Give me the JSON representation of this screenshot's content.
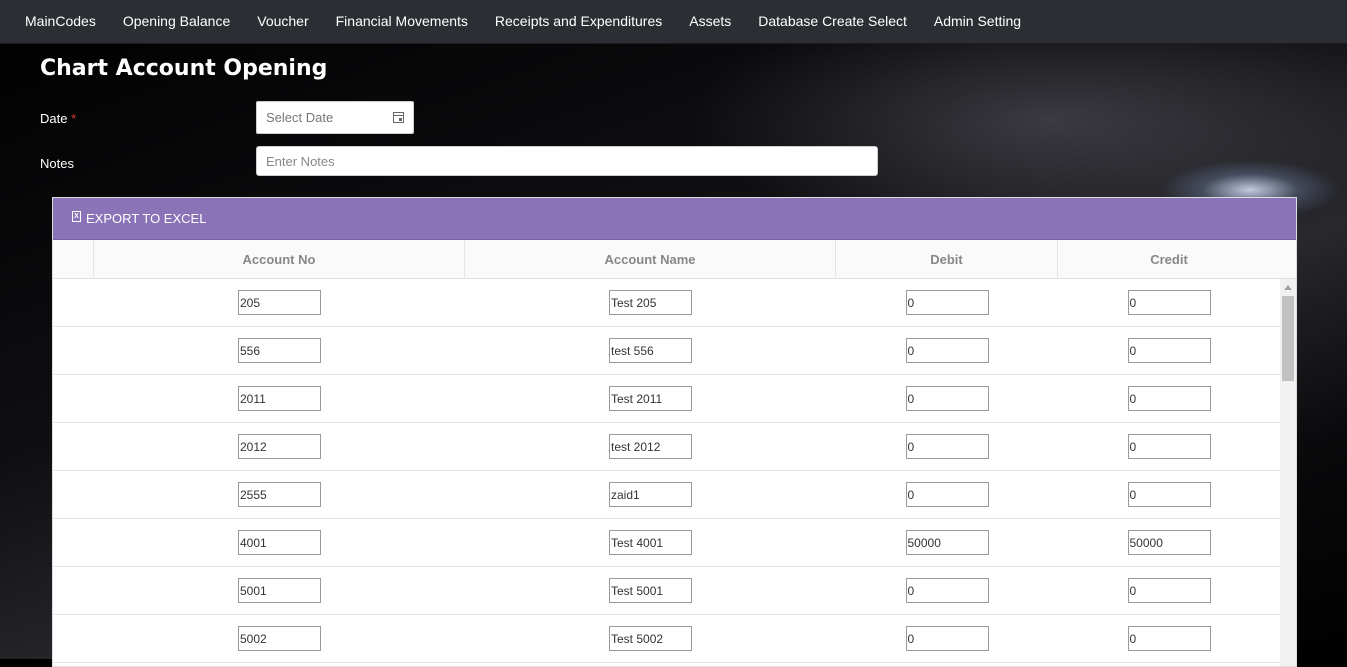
{
  "nav": {
    "items": [
      "MainCodes",
      "Opening Balance",
      "Voucher",
      "Financial Movements",
      "Receipts and Expenditures",
      "Assets",
      "Database Create Select",
      "Admin Setting"
    ]
  },
  "page": {
    "title": "Chart Account Opening"
  },
  "form": {
    "date_label": "Date",
    "date_required": "*",
    "date_placeholder": "Select Date",
    "notes_label": "Notes",
    "notes_placeholder": "Enter Notes"
  },
  "grid": {
    "export_label": "EXPORT TO EXCEL",
    "columns": [
      "",
      "Account No",
      "Account Name",
      "Debit",
      "Credit"
    ],
    "rows": [
      {
        "account_no": "205",
        "account_name": "Test 205",
        "debit": "0",
        "credit": "0"
      },
      {
        "account_no": "556",
        "account_name": "test 556",
        "debit": "0",
        "credit": "0"
      },
      {
        "account_no": "2011",
        "account_name": "Test 2011",
        "debit": "0",
        "credit": "0"
      },
      {
        "account_no": "2012",
        "account_name": "test 2012",
        "debit": "0",
        "credit": "0"
      },
      {
        "account_no": "2555",
        "account_name": "zaid1",
        "debit": "0",
        "credit": "0"
      },
      {
        "account_no": "4001",
        "account_name": "Test 4001",
        "debit": "50000",
        "credit": "50000"
      },
      {
        "account_no": "5001",
        "account_name": "Test 5001",
        "debit": "0",
        "credit": "0"
      },
      {
        "account_no": "5002",
        "account_name": "Test 5002",
        "debit": "0",
        "credit": "0"
      }
    ]
  },
  "icons": {
    "export": "excel-icon",
    "date": "calendar-icon"
  },
  "colors": {
    "navbar": "#2b2e33",
    "toolbar": "#8a74b7",
    "required": "#e53935"
  }
}
